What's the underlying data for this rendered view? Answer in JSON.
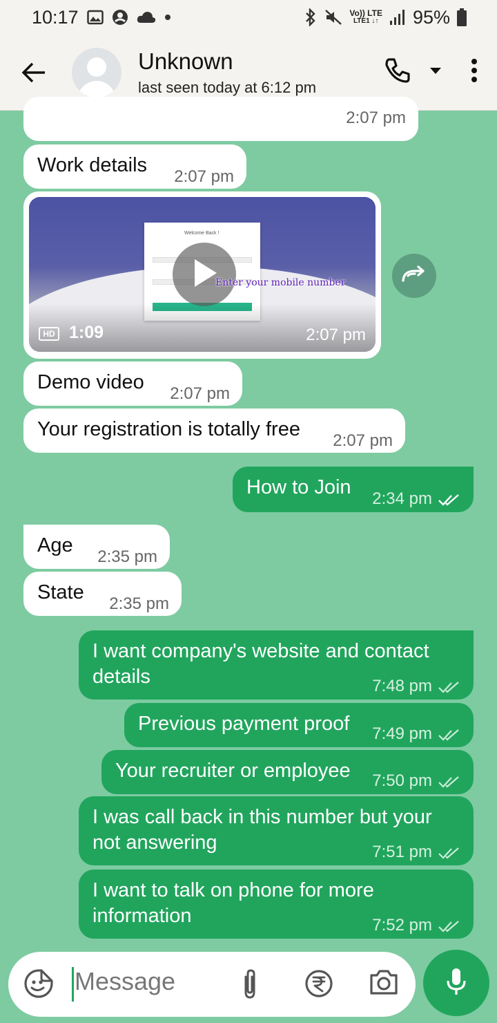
{
  "status_bar": {
    "time": "10:17",
    "battery": "95%",
    "network_top": "Vo)) LTE",
    "network_bottom": "LTE1 ↓↑",
    "icons": [
      "image-icon",
      "account-icon",
      "cloud-icon",
      "bluetooth-icon",
      "mute-icon",
      "signal-icon",
      "battery-icon"
    ]
  },
  "header": {
    "contact_name": "Unknown",
    "last_seen": "last seen today at 6:12 pm"
  },
  "messages": [
    {
      "direction": "in",
      "text": "",
      "time": "2:07 pm"
    },
    {
      "direction": "in",
      "text": "Work details",
      "time": "2:07 pm"
    },
    {
      "direction": "in",
      "type": "video",
      "duration": "1:09",
      "badge": "HD",
      "time": "2:07 pm",
      "overlay_text": "Enter your mobile number",
      "thumb_title": "Welcome Back !"
    },
    {
      "direction": "in",
      "text": "Demo video",
      "time": "2:07 pm"
    },
    {
      "direction": "in",
      "text": "Your registration is totally free",
      "time": "2:07 pm"
    },
    {
      "direction": "out",
      "text": "How to Join",
      "time": "2:34 pm",
      "status": "read"
    },
    {
      "direction": "in",
      "text": "Age",
      "time": "2:35 pm"
    },
    {
      "direction": "in",
      "text": "State",
      "time": "2:35 pm"
    },
    {
      "direction": "out",
      "line1": "I want company's website and contact",
      "line2": "details",
      "time": "7:48 pm",
      "status": "delivered"
    },
    {
      "direction": "out",
      "text": "Previous payment proof",
      "time": "7:49 pm",
      "status": "delivered"
    },
    {
      "direction": "out",
      "text": "Your recruiter or employee",
      "time": "7:50 pm",
      "status": "delivered"
    },
    {
      "direction": "out",
      "line1": "I was call back in this number but your",
      "line2": "not answering",
      "time": "7:51 pm",
      "status": "delivered"
    },
    {
      "direction": "out",
      "line1": "I want to talk on phone for more",
      "line2": "information",
      "time": "7:52 pm",
      "status": "delivered"
    }
  ],
  "composer": {
    "placeholder": "Message"
  },
  "colors": {
    "chat_background": "#7ecba1",
    "outgoing_bubble": "#21a55d",
    "incoming_bubble": "#ffffff",
    "header_background": "#f5f3ef"
  }
}
